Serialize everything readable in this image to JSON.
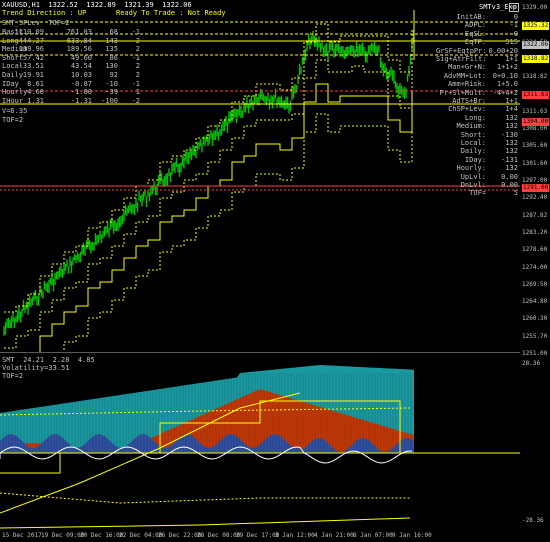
{
  "symbol_line": "XAUUSD,H1  1322.52  1322.89  1321.39  1322.06",
  "trend_direction": "Trend Direction : UP",
  "trade_status": "Ready To Trade : Not Ready",
  "indicator_title": "SMT_SPLev  TOF=2",
  "stats_rows": [
    {
      "label": "Basic",
      "a": "1110.09",
      "b": "761.03",
      "c": "68",
      "d": "-1"
    },
    {
      "label": "Long",
      "a": "444.27",
      "b": "633.84",
      "c": "143",
      "d": "2"
    },
    {
      "label": "Medium",
      "a": "139.96",
      "b": "189.56",
      "c": "135",
      "d": "2"
    },
    {
      "label": "Short",
      "a": "57.42",
      "b": "49.60",
      "c": "86",
      "d": "-1"
    },
    {
      "label": "Local",
      "a": "-33.51",
      "b": "43.54",
      "c": "130",
      "d": "2"
    },
    {
      "label": "Daily",
      "a": "19.91",
      "b": "10.03",
      "c": "92",
      "d": "2"
    },
    {
      "label": "IDay",
      "a": "8.61",
      "b": "-0.87",
      "c": "-10",
      "d": "-1"
    },
    {
      "label": "Hourly",
      "a": "4.60",
      "b": "-1.80",
      "c": "-39",
      "d": "1"
    },
    {
      "label": "IHour",
      "a": "1.31",
      "b": "-1.31",
      "c": "-100",
      "d": "-2"
    }
  ],
  "v_line": "V=6.35",
  "tof_line": "TOF=2",
  "top_right_title": "SMTv3_Exp",
  "right_panel": [
    {
      "k": "InitAB:",
      "v": "0"
    },
    {
      "k": "ADPL:",
      "v": "-1"
    },
    {
      "k": "EqSL:",
      "v": "0"
    },
    {
      "k": "EqTP:",
      "v": "515"
    },
    {
      "k": "GrSF+EqtpPr:",
      "v": "0.00+20"
    },
    {
      "k": "Sig+AtrFilt:",
      "v": "1+1"
    },
    {
      "k": "Man+Gr+N:",
      "v": "1+1+2"
    },
    {
      "k": "AdvMM+Lot:",
      "v": "0+0.10"
    },
    {
      "k": "Amm+Risk:",
      "v": "1+5.0"
    },
    {
      "k": "Pr+Sl+Mult:",
      "v": "-4+4+2"
    },
    {
      "k": "AdTS+Br:",
      "v": "1+1"
    },
    {
      "k": "ChSP+Lev:",
      "v": "1+4"
    },
    {
      "k": "Long:",
      "v": "132"
    },
    {
      "k": "Medium:",
      "v": "132"
    },
    {
      "k": "Short:",
      "v": "-130"
    },
    {
      "k": "Local:",
      "v": "132"
    },
    {
      "k": "Daily:",
      "v": "132"
    },
    {
      "k": "IDay:",
      "v": "-131"
    },
    {
      "k": "Hourly:",
      "v": "132"
    },
    {
      "k": "UpLvl:",
      "v": "0.00"
    },
    {
      "k": "DnLvl:",
      "v": "0.00"
    },
    {
      "k": "TOF=",
      "v": "5"
    }
  ],
  "price_axis": [
    "1329.00",
    "1325.32",
    "1324.50",
    "1322.06",
    "1318.82",
    "1315.45",
    "1311.63",
    "1308.00",
    "1305.60",
    "1301.60",
    "1297.00",
    "1292.40",
    "1287.82",
    "1283.20",
    "1278.60",
    "1274.00",
    "1269.50",
    "1264.80",
    "1260.30",
    "1255.70",
    "1251.00"
  ],
  "price_tags": [
    {
      "v": "1325.32",
      "color": "#ffff00"
    },
    {
      "v": "1322.06",
      "color": "#c0c0c0"
    },
    {
      "v": "1318.82",
      "color": "#ffff00"
    },
    {
      "v": "1311.63",
      "color": "#ff4040"
    },
    {
      "v": "1304.00",
      "color": "#ff4040"
    },
    {
      "v": "1291.00",
      "color": "#ff4040"
    }
  ],
  "sub_title": "SMT  24.21  2.28  4.85",
  "sub_volatility": "Volatility=33.51",
  "sub_tof": "TOF=2",
  "sub_axis": [
    "28.36",
    "-28.36"
  ],
  "dates": [
    "15 Dec 2017",
    "19 Dec 09:00",
    "20 Dec 16:00",
    "22 Dec 04:00",
    "26 Dec 22:00",
    "28 Dec 08:00",
    "29 Dec 17:00",
    "3 Jan 12:00",
    "4 Jan 21:00",
    "8 Jan 07:00",
    "9 Jan 16:00"
  ]
}
